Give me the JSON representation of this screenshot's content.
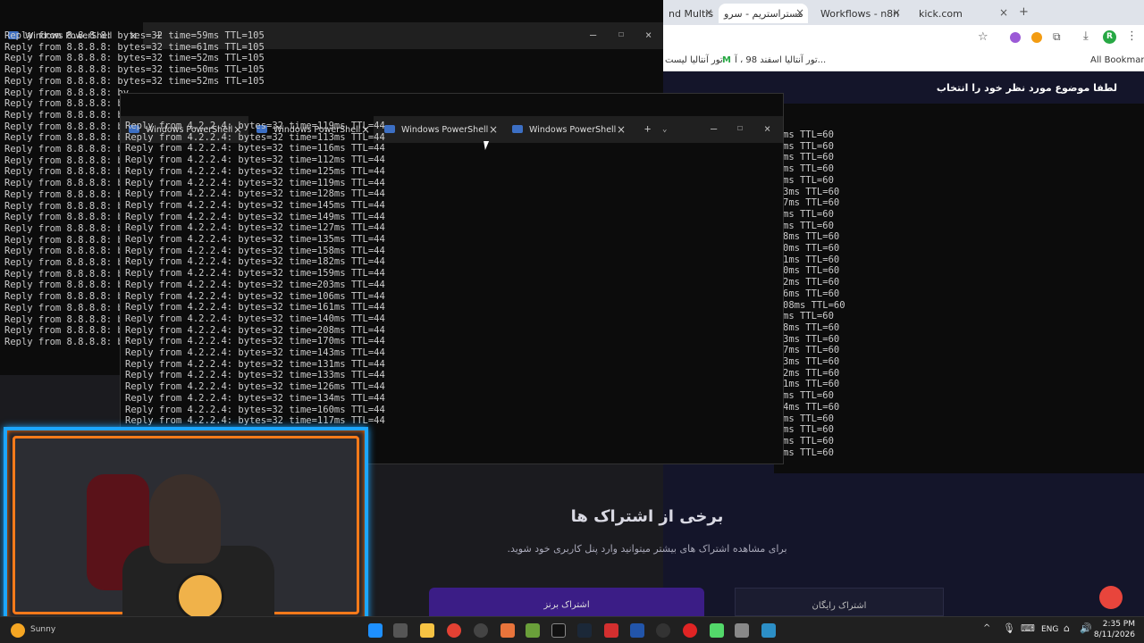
{
  "browser": {
    "tabs": [
      {
        "label": "nd Multis",
        "active": false
      },
      {
        "label": "مستراستریم - سرو",
        "active": true
      },
      {
        "label": "Workflows - n8n",
        "active": false
      },
      {
        "label": "kick.com",
        "active": false
      }
    ],
    "bookmarks": [
      "تور آنتالیا لیست",
      "M",
      "تور آنتالیا اسفند 98 ، آ...",
      "All Bookmarks"
    ],
    "site_notice": "لطفا موضوع مورد نظر خود را انتخاب",
    "heading": "برخی از اشتراک ها",
    "subtext": "برای مشاهده اشتراک های بیشتر میتوانید وارد پنل کاربری خود شوید.",
    "plan_left": "اشتراک برنز",
    "plan_right": "اشتراک رایگان"
  },
  "terminal1": {
    "tab": "Windows PowerShell",
    "lines": [
      "Reply from 8.8.8.8: bytes=32 time=59ms TTL=105",
      "Reply from 8.8.8.8: bytes=32 time=61ms TTL=105",
      "Reply from 8.8.8.8: bytes=32 time=52ms TTL=105",
      "Reply from 8.8.8.8: bytes=32 time=50ms TTL=105",
      "Reply from 8.8.8.8: bytes=32 time=52ms TTL=105",
      "Reply from 8.8.8.8: by",
      "Reply from 8.8.8.8: by",
      "Reply from 8.8.8.8: by",
      "Reply from 8.8.8.8: by",
      "Reply from 8.8.8.8: by",
      "Reply from 8.8.8.8: by",
      "Reply from 8.8.8.8: by",
      "Reply from 8.8.8.8: by",
      "Reply from 8.8.8.8: by",
      "Reply from 8.8.8.8: by",
      "Reply from 8.8.8.8: by",
      "Reply from 8.8.8.8: by",
      "Reply from 8.8.8.8: by",
      "Reply from 8.8.8.8: by",
      "Reply from 8.8.8.8: by",
      "Reply from 8.8.8.8: by",
      "Reply from 8.8.8.8: by",
      "Reply from 8.8.8.8: by",
      "Reply from 8.8.8.8: by",
      "Reply from 8.8.8.8: by",
      "Reply from 8.8.8.8: by",
      "Reply from 8.8.8.8: by",
      "Reply from 8.8.8.8: by"
    ]
  },
  "terminal2": {
    "tabs": [
      "Windows PowerShell",
      "Windows PowerShell",
      "Windows PowerShell",
      "Windows PowerShell"
    ],
    "lines": [
      "Reply from 4.2.2.4: bytes=32 time=119ms TTL=44",
      "Reply from 4.2.2.4: bytes=32 time=113ms TTL=44",
      "Reply from 4.2.2.4: bytes=32 time=116ms TTL=44",
      "Reply from 4.2.2.4: bytes=32 time=112ms TTL=44",
      "Reply from 4.2.2.4: bytes=32 time=125ms TTL=44",
      "Reply from 4.2.2.4: bytes=32 time=119ms TTL=44",
      "Reply from 4.2.2.4: bytes=32 time=128ms TTL=44",
      "Reply from 4.2.2.4: bytes=32 time=145ms TTL=44",
      "Reply from 4.2.2.4: bytes=32 time=149ms TTL=44",
      "Reply from 4.2.2.4: bytes=32 time=127ms TTL=44",
      "Reply from 4.2.2.4: bytes=32 time=135ms TTL=44",
      "Reply from 4.2.2.4: bytes=32 time=158ms TTL=44",
      "Reply from 4.2.2.4: bytes=32 time=182ms TTL=44",
      "Reply from 4.2.2.4: bytes=32 time=159ms TTL=44",
      "Reply from 4.2.2.4: bytes=32 time=203ms TTL=44",
      "Reply from 4.2.2.4: bytes=32 time=106ms TTL=44",
      "Reply from 4.2.2.4: bytes=32 time=161ms TTL=44",
      "Reply from 4.2.2.4: bytes=32 time=140ms TTL=44",
      "Reply from 4.2.2.4: bytes=32 time=208ms TTL=44",
      "Reply from 4.2.2.4: bytes=32 time=170ms TTL=44",
      "Reply from 4.2.2.4: bytes=32 time=143ms TTL=44",
      "Reply from 4.2.2.4: bytes=32 time=131ms TTL=44",
      "Reply from 4.2.2.4: bytes=32 time=133ms TTL=44",
      "Reply from 4.2.2.4: bytes=32 time=126ms TTL=44",
      "Reply from 4.2.2.4: bytes=32 time=134ms TTL=44",
      "Reply from 4.2.2.4: bytes=32 time=160ms TTL=44",
      "Reply from 4.2.2.4: bytes=32 time=117ms TTL=44"
    ]
  },
  "terminal3": {
    "lines": [
      "ms TTL=60",
      "ms TTL=60",
      "ms TTL=60",
      "ms TTL=60",
      "ms TTL=60",
      "3ms TTL=60",
      "7ms TTL=60",
      "ms TTL=60",
      "ms TTL=60",
      "8ms TTL=60",
      "0ms TTL=60",
      "1ms TTL=60",
      "0ms TTL=60",
      "2ms TTL=60",
      "6ms TTL=60",
      "08ms TTL=60",
      "ms TTL=60",
      "8ms TTL=60",
      "3ms TTL=60",
      "7ms TTL=60",
      "3ms TTL=60",
      "2ms TTL=60",
      "1ms TTL=60",
      "ms TTL=60",
      "4ms TTL=60",
      "ms TTL=60",
      "ms TTL=60",
      "ms TTL=60",
      "ms TTL=60"
    ]
  },
  "taskbar": {
    "weather": "Sunny",
    "lang": "ENG",
    "time": "2:35 PM",
    "date": "8/11/2026"
  }
}
